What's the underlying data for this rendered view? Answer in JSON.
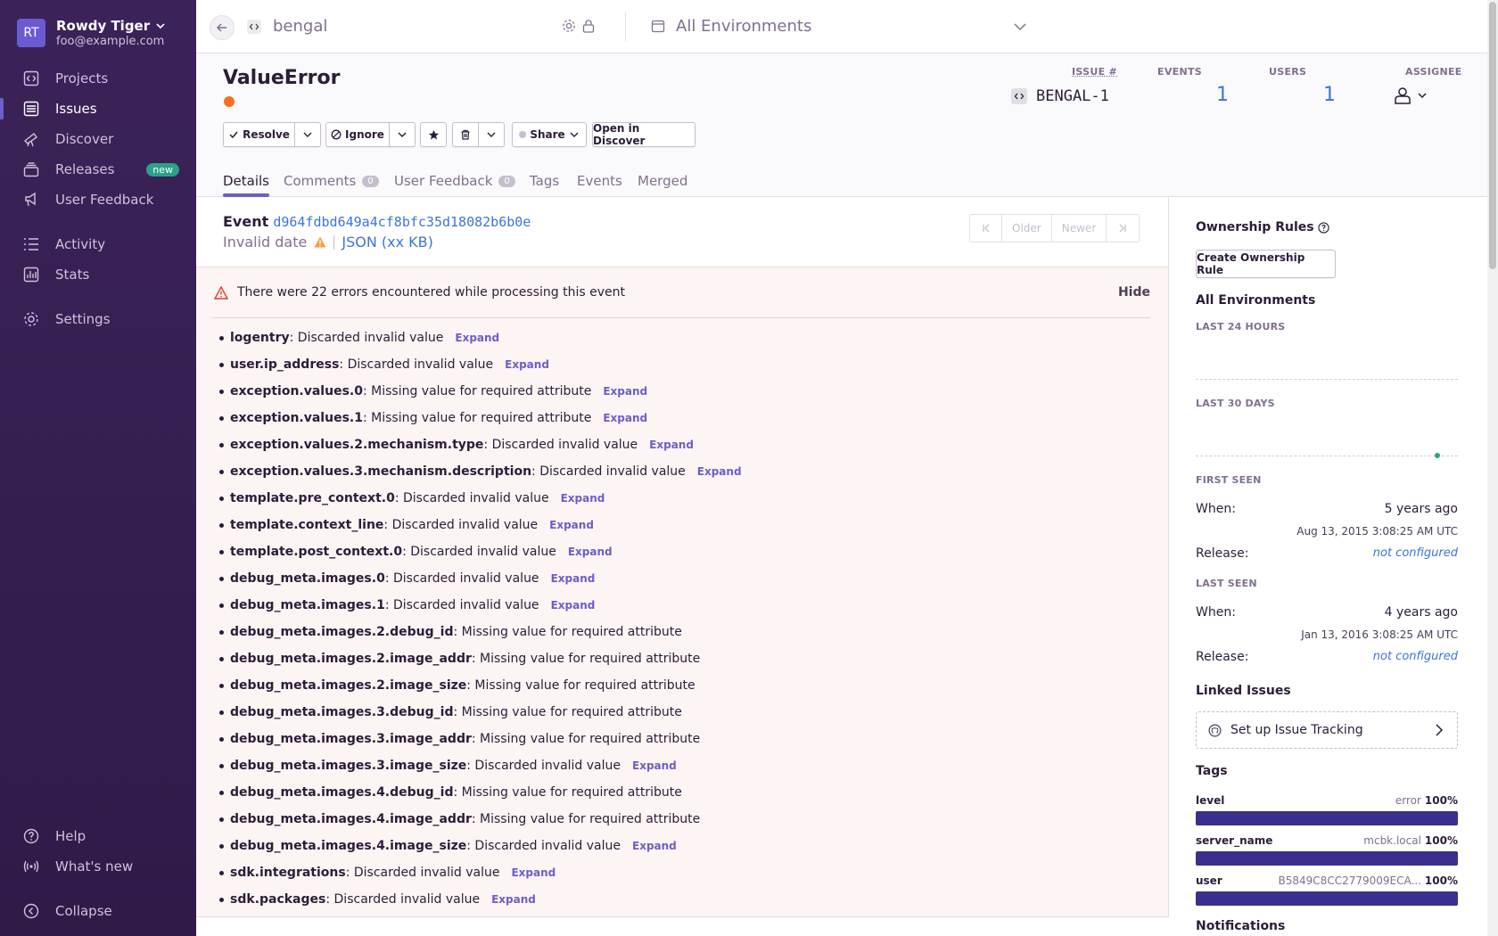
{
  "org": {
    "initials": "RT",
    "name": "Rowdy Tiger",
    "email": "foo@example.com"
  },
  "nav": {
    "projects": "Projects",
    "issues": "Issues",
    "discover": "Discover",
    "releases": "Releases",
    "releases_badge": "new",
    "user_feedback": "User Feedback",
    "activity": "Activity",
    "stats": "Stats",
    "settings": "Settings",
    "help": "Help",
    "whats_new": "What's new",
    "collapse": "Collapse"
  },
  "topbar": {
    "project": "bengal",
    "environment": "All Environments"
  },
  "issue": {
    "title": "ValueError",
    "level_color": "#f5701f",
    "issue_label": "ISSUE #",
    "short_id": "BENGAL-1",
    "events_label": "EVENTS",
    "events": "1",
    "users_label": "USERS",
    "users": "1",
    "assignee_label": "ASSIGNEE"
  },
  "actions": {
    "resolve": "Resolve",
    "ignore": "Ignore",
    "share": "Share",
    "open_discover": "Open in Discover"
  },
  "tabs": {
    "details": "Details",
    "comments": "Comments",
    "comments_count": "0",
    "user_feedback": "User Feedback",
    "user_feedback_count": "0",
    "tags": "Tags",
    "events": "Events",
    "merged": "Merged"
  },
  "event": {
    "label": "Event",
    "id": "d964fdbd649a4cf8bfc35d18082b6b0e",
    "date": "Invalid date",
    "json": "JSON (xx KB)",
    "older": "Older",
    "newer": "Newer"
  },
  "errors": {
    "message": "There were 22 errors encountered while processing this event",
    "hide": "Hide",
    "expand": "Expand",
    "items": [
      {
        "key": "logentry",
        "text": ": Discarded invalid value",
        "expand": true
      },
      {
        "key": "user.ip_address",
        "text": ": Discarded invalid value",
        "expand": true
      },
      {
        "key": "exception.values.0",
        "text": ": Missing value for required attribute",
        "expand": true
      },
      {
        "key": "exception.values.1",
        "text": ": Missing value for required attribute",
        "expand": true
      },
      {
        "key": "exception.values.2.mechanism.type",
        "text": ": Discarded invalid value",
        "expand": true
      },
      {
        "key": "exception.values.3.mechanism.description",
        "text": ": Discarded invalid value",
        "expand": true
      },
      {
        "key": "template.pre_context.0",
        "text": ": Discarded invalid value",
        "expand": true
      },
      {
        "key": "template.context_line",
        "text": ": Discarded invalid value",
        "expand": true
      },
      {
        "key": "template.post_context.0",
        "text": ": Discarded invalid value",
        "expand": true
      },
      {
        "key": "debug_meta.images.0",
        "text": ": Discarded invalid value",
        "expand": true
      },
      {
        "key": "debug_meta.images.1",
        "text": ": Discarded invalid value",
        "expand": true
      },
      {
        "key": "debug_meta.images.2.debug_id",
        "text": ": Missing value for required attribute",
        "expand": false
      },
      {
        "key": "debug_meta.images.2.image_addr",
        "text": ": Missing value for required attribute",
        "expand": false
      },
      {
        "key": "debug_meta.images.2.image_size",
        "text": ": Missing value for required attribute",
        "expand": false
      },
      {
        "key": "debug_meta.images.3.debug_id",
        "text": ": Missing value for required attribute",
        "expand": false
      },
      {
        "key": "debug_meta.images.3.image_addr",
        "text": ": Missing value for required attribute",
        "expand": false
      },
      {
        "key": "debug_meta.images.3.image_size",
        "text": ": Discarded invalid value",
        "expand": true
      },
      {
        "key": "debug_meta.images.4.debug_id",
        "text": ": Missing value for required attribute",
        "expand": false
      },
      {
        "key": "debug_meta.images.4.image_addr",
        "text": ": Missing value for required attribute",
        "expand": false
      },
      {
        "key": "debug_meta.images.4.image_size",
        "text": ": Discarded invalid value",
        "expand": true
      },
      {
        "key": "sdk.integrations",
        "text": ": Discarded invalid value",
        "expand": true
      },
      {
        "key": "sdk.packages",
        "text": ": Discarded invalid value",
        "expand": true
      }
    ]
  },
  "sidebar": {
    "ownership_title": "Ownership Rules",
    "create_rule": "Create Ownership Rule",
    "environments": "All Environments",
    "last_24h": "LAST 24 HOURS",
    "last_30d": "LAST 30 DAYS",
    "first_seen": "FIRST SEEN",
    "first_when_label": "When:",
    "first_when": "5 years ago",
    "first_date": "Aug 13, 2015 3:08:25 AM UTC",
    "release_label": "Release:",
    "not_configured": "not configured",
    "last_seen": "LAST SEEN",
    "last_when": "4 years ago",
    "last_date": "Jan 13, 2016 3:08:25 AM UTC",
    "linked_issues": "Linked Issues",
    "setup_tracking": "Set up Issue Tracking",
    "tags_title": "Tags",
    "tags": [
      {
        "key": "level",
        "value": "error",
        "pct": "100%"
      },
      {
        "key": "server_name",
        "value": "mcbk.local",
        "pct": "100%"
      },
      {
        "key": "user",
        "value": "B5849C8CC2779009ECA...",
        "pct": "100%"
      }
    ],
    "notifications": "Notifications"
  }
}
